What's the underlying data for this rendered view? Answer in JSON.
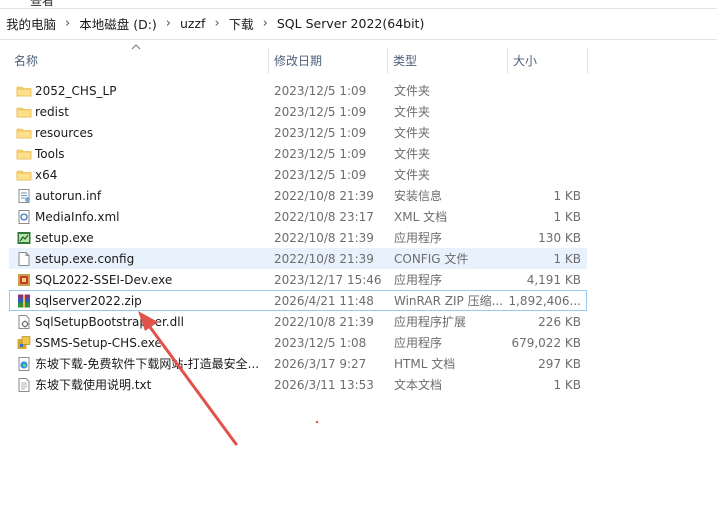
{
  "top_strip_text": "查看",
  "breadcrumb": [
    "我的电脑",
    "本地磁盘 (D:)",
    "uzzf",
    "下载",
    "SQL Server 2022(64bit)"
  ],
  "breadcrumb_separator": "›",
  "columns": {
    "name": "名称",
    "date": "修改日期",
    "type": "类型",
    "size": "大小"
  },
  "files": [
    {
      "name": "2052_CHS_LP",
      "date": "2023/12/5 1:09",
      "type": "文件夹",
      "size": "",
      "icon": "folder-icon"
    },
    {
      "name": "redist",
      "date": "2023/12/5 1:09",
      "type": "文件夹",
      "size": "",
      "icon": "folder-icon"
    },
    {
      "name": "resources",
      "date": "2023/12/5 1:09",
      "type": "文件夹",
      "size": "",
      "icon": "folder-icon"
    },
    {
      "name": "Tools",
      "date": "2023/12/5 1:09",
      "type": "文件夹",
      "size": "",
      "icon": "folder-icon"
    },
    {
      "name": "x64",
      "date": "2023/12/5 1:09",
      "type": "文件夹",
      "size": "",
      "icon": "folder-icon"
    },
    {
      "name": "autorun.inf",
      "date": "2022/10/8 21:39",
      "type": "安装信息",
      "size": "1 KB",
      "icon": "setup-info-icon"
    },
    {
      "name": "MediaInfo.xml",
      "date": "2022/10/8 23:17",
      "type": "XML 文档",
      "size": "1 KB",
      "icon": "xml-file-icon"
    },
    {
      "name": "setup.exe",
      "date": "2022/10/8 21:39",
      "type": "应用程序",
      "size": "130 KB",
      "icon": "setup-exe-icon"
    },
    {
      "name": "setup.exe.config",
      "date": "2022/10/8 21:39",
      "type": "CONFIG 文件",
      "size": "1 KB",
      "icon": "blank-file-icon"
    },
    {
      "name": "SQL2022-SSEI-Dev.exe",
      "date": "2023/12/17 15:46",
      "type": "应用程序",
      "size": "4,191 KB",
      "icon": "sql-installer-icon"
    },
    {
      "name": "sqlserver2022.zip",
      "date": "2026/4/21 11:48",
      "type": "WinRAR ZIP 压缩...",
      "size": "1,892,406...",
      "icon": "winrar-archive-icon"
    },
    {
      "name": "SqlSetupBootstrapper.dll",
      "date": "2022/10/8 21:39",
      "type": "应用程序扩展",
      "size": "226 KB",
      "icon": "dll-file-icon"
    },
    {
      "name": "SSMS-Setup-CHS.exe",
      "date": "2023/12/5 1:08",
      "type": "应用程序",
      "size": "679,022 KB",
      "icon": "ssms-installer-icon"
    },
    {
      "name": "东坡下载-免费软件下载网站-打造最安全...",
      "date": "2026/3/17 9:27",
      "type": "HTML 文档",
      "size": "297 KB",
      "icon": "edge-html-icon"
    },
    {
      "name": "东坡下载使用说明.txt",
      "date": "2026/3/11 13:53",
      "type": "文本文档",
      "size": "1 KB",
      "icon": "text-file-icon"
    }
  ],
  "highlight_states": {
    "hover_row": 8,
    "selected_row": 10
  },
  "colors": {
    "hover_bg": "#e8f2fc",
    "selected_border": "#99c9ef",
    "header_text": "#4c607a",
    "folder": "#f8d775",
    "annotation_arrow": "#e0524a"
  }
}
